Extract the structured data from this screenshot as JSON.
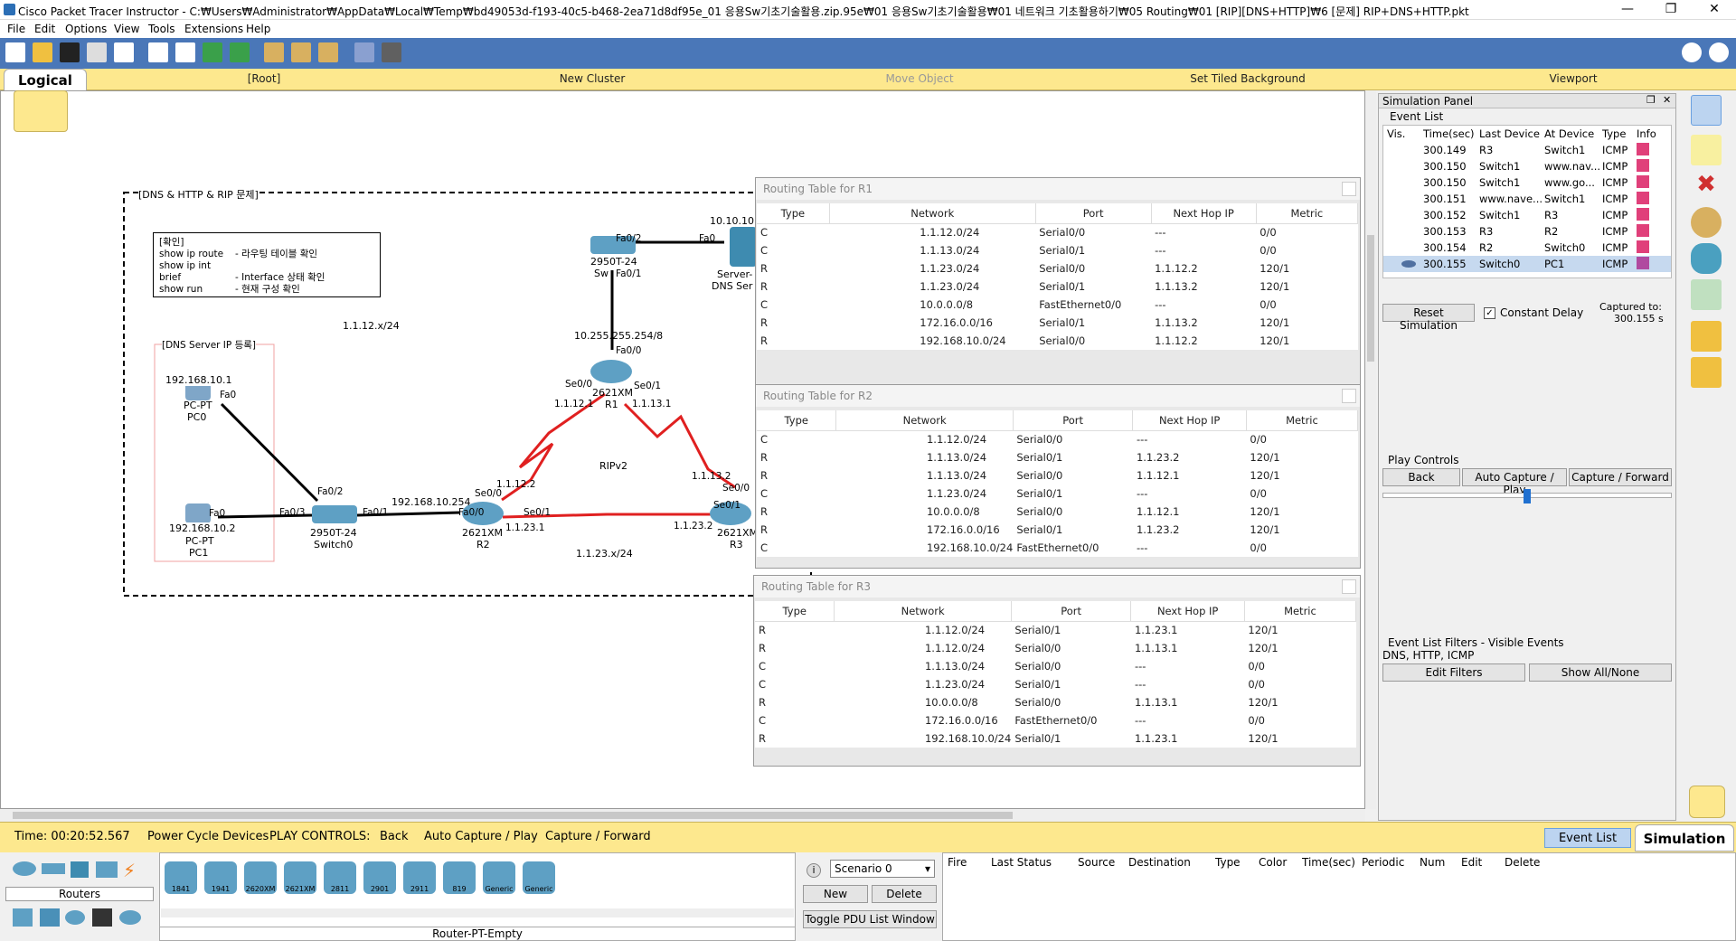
{
  "window": {
    "title": "Cisco Packet Tracer Instructor - C:₩Users₩Administrator₩AppData₩Local₩Temp₩bd49053d-f193-40c5-b468-2ea71d8df95e_01 응용Sw기초기술활용.zip.95e₩01 응용Sw기초기술활용₩01 네트워크 기초활용하기₩05 Routing₩01 [RIP][DNS+HTTP]₩6 [문제] RIP+DNS+HTTP.pkt"
  },
  "menu": [
    "File",
    "Edit",
    "Options",
    "View",
    "Tools",
    "Extensions",
    "Help"
  ],
  "logicalbar": {
    "logical": "Logical",
    "root": "[Root]",
    "new_cluster": "New Cluster",
    "move_object": "Move Object",
    "set_tiled_bg": "Set Tiled Background",
    "viewport": "Viewport"
  },
  "topology": {
    "cluster_label": "[DNS & HTTP & RIP 문제]",
    "note_title": "[확인]",
    "note_lines": [
      {
        "cmd": "show ip route",
        "desc": "- 라우팅 테이블 확인"
      },
      {
        "cmd": "show ip int brief",
        "desc": "- Interface 상태 확인"
      },
      {
        "cmd": "show run",
        "desc": "- 현재 구성 확인"
      }
    ],
    "dns_box_label": "[DNS Server IP 등록]",
    "net_1_1_12": "1.1.12.x/24",
    "net_1_1_23": "1.1.23.x/24",
    "ripv2": "RIPv2",
    "pc0": {
      "ip": "192.168.10.1",
      "model": "PC-PT",
      "name": "PC0",
      "port": "Fa0"
    },
    "pc1": {
      "ip": "192.168.10.2",
      "model": "PC-PT",
      "name": "PC1",
      "port": "Fa0"
    },
    "switch0": {
      "model": "2950T-24",
      "name": "Switch0",
      "p1": "Fa0/2",
      "p2": "Fa0/3",
      "p3": "Fa0/1"
    },
    "r2": {
      "model": "2621XM",
      "name": "R2",
      "fa": "Fa0/0",
      "se0": "Se0/0",
      "se1": "Se0/1",
      "gw": "192.168.10.254",
      "ip12": "1.1.12.2",
      "ip23": "1.1.23.1"
    },
    "r1": {
      "model": "2621XM",
      "name": "R1",
      "fa": "Fa0/0",
      "se0": "Se0/0",
      "se1": "Se0/1",
      "ip12": "1.1.12.1",
      "ip13": "1.1.13.1",
      "lan": "10.255.255.254/8"
    },
    "r3": {
      "model": "2621XM",
      "name": "R3",
      "se0": "Se0/0",
      "se1": "Se0/1",
      "ip13": "1.1.13.2",
      "ip23": "1.1.23.2"
    },
    "switch1": {
      "model": "2950T-24",
      "name": "Sw",
      "p1": "Fa0/2",
      "p2": "Fa0/1"
    },
    "server": {
      "name": "Server-",
      "name2": "DNS Ser",
      "ip": "10.10.10.",
      "port": "Fa0"
    }
  },
  "routing_tables": [
    {
      "title": "Routing Table for R1",
      "headers": [
        "Type",
        "Network",
        "Port",
        "Next Hop IP",
        "Metric"
      ],
      "rows": [
        [
          "C",
          "1.1.12.0/24",
          "Serial0/0",
          "---",
          "0/0"
        ],
        [
          "C",
          "1.1.13.0/24",
          "Serial0/1",
          "---",
          "0/0"
        ],
        [
          "R",
          "1.1.23.0/24",
          "Serial0/0",
          "1.1.12.2",
          "120/1"
        ],
        [
          "R",
          "1.1.23.0/24",
          "Serial0/1",
          "1.1.13.2",
          "120/1"
        ],
        [
          "C",
          "10.0.0.0/8",
          "FastEthernet0/0",
          "---",
          "0/0"
        ],
        [
          "R",
          "172.16.0.0/16",
          "Serial0/1",
          "1.1.13.2",
          "120/1"
        ],
        [
          "R",
          "192.168.10.0/24",
          "Serial0/0",
          "1.1.12.2",
          "120/1"
        ]
      ]
    },
    {
      "title": "Routing Table for R2",
      "headers": [
        "Type",
        "Network",
        "Port",
        "Next Hop IP",
        "Metric"
      ],
      "rows": [
        [
          "C",
          "1.1.12.0/24",
          "Serial0/0",
          "---",
          "0/0"
        ],
        [
          "R",
          "1.1.13.0/24",
          "Serial0/1",
          "1.1.23.2",
          "120/1"
        ],
        [
          "R",
          "1.1.13.0/24",
          "Serial0/0",
          "1.1.12.1",
          "120/1"
        ],
        [
          "C",
          "1.1.23.0/24",
          "Serial0/1",
          "---",
          "0/0"
        ],
        [
          "R",
          "10.0.0.0/8",
          "Serial0/0",
          "1.1.12.1",
          "120/1"
        ],
        [
          "R",
          "172.16.0.0/16",
          "Serial0/1",
          "1.1.23.2",
          "120/1"
        ],
        [
          "C",
          "192.168.10.0/24",
          "FastEthernet0/0",
          "---",
          "0/0"
        ]
      ]
    },
    {
      "title": "Routing Table for R3",
      "headers": [
        "Type",
        "Network",
        "Port",
        "Next Hop IP",
        "Metric"
      ],
      "rows": [
        [
          "R",
          "1.1.12.0/24",
          "Serial0/1",
          "1.1.23.1",
          "120/1"
        ],
        [
          "R",
          "1.1.12.0/24",
          "Serial0/0",
          "1.1.13.1",
          "120/1"
        ],
        [
          "C",
          "1.1.13.0/24",
          "Serial0/0",
          "---",
          "0/0"
        ],
        [
          "C",
          "1.1.23.0/24",
          "Serial0/1",
          "---",
          "0/0"
        ],
        [
          "R",
          "10.0.0.0/8",
          "Serial0/0",
          "1.1.13.1",
          "120/1"
        ],
        [
          "C",
          "172.16.0.0/16",
          "FastEthernet0/0",
          "---",
          "0/0"
        ],
        [
          "R",
          "192.168.10.0/24",
          "Serial0/1",
          "1.1.23.1",
          "120/1"
        ]
      ]
    }
  ],
  "sim_panel": {
    "title": "Simulation Panel",
    "event_list": "Event List",
    "headers": [
      "Vis.",
      "Time(sec)",
      "Last Device",
      "At Device",
      "Type",
      "Info"
    ],
    "events": [
      {
        "time": "300.149",
        "last": "R3",
        "at": "Switch1",
        "type": "ICMP",
        "color": "#e0407a"
      },
      {
        "time": "300.150",
        "last": "Switch1",
        "at": "www.nav...",
        "type": "ICMP",
        "color": "#e0407a"
      },
      {
        "time": "300.150",
        "last": "Switch1",
        "at": "www.go...",
        "type": "ICMP",
        "color": "#e0407a"
      },
      {
        "time": "300.151",
        "last": "www.nave...",
        "at": "Switch1",
        "type": "ICMP",
        "color": "#e0407a"
      },
      {
        "time": "300.152",
        "last": "Switch1",
        "at": "R3",
        "type": "ICMP",
        "color": "#e0407a"
      },
      {
        "time": "300.153",
        "last": "R3",
        "at": "R2",
        "type": "ICMP",
        "color": "#e0407a"
      },
      {
        "time": "300.154",
        "last": "R2",
        "at": "Switch0",
        "type": "ICMP",
        "color": "#e0407a"
      },
      {
        "time": "300.155",
        "last": "Switch0",
        "at": "PC1",
        "type": "ICMP",
        "color": "#b04aa0"
      }
    ],
    "reset": "Reset Simulation",
    "constant_delay": "Constant Delay",
    "captured_label": "Captured to:",
    "captured_value": "300.155 s",
    "play_controls": "Play Controls",
    "back": "Back",
    "auto_capture": "Auto Capture / Play",
    "capture_forward": "Capture / Forward",
    "filters_title": "Event List Filters - Visible Events",
    "filters_value": "DNS, HTTP, ICMP",
    "edit_filters": "Edit Filters",
    "show_all": "Show All/None"
  },
  "statusbar": {
    "time": "Time: 00:20:52.567",
    "power_cycle": "Power Cycle Devices",
    "play_controls": "PLAY CONTROLS:",
    "back": "Back",
    "auto_capture": "Auto Capture / Play",
    "capture_forward": "Capture / Forward",
    "event_list": "Event List",
    "simulation": "Simulation"
  },
  "bottom": {
    "category": "Routers",
    "models": [
      "1841",
      "1941",
      "2620XM",
      "2621XM",
      "2811",
      "2901",
      "2911",
      "819",
      "Generic",
      "Generic"
    ],
    "selected_model": "Router-PT-Empty",
    "scenario": "Scenario 0",
    "new": "New",
    "delete": "Delete",
    "toggle_pdu": "Toggle PDU List Window",
    "pdu_headers": [
      "Fire",
      "Last Status",
      "Source",
      "Destination",
      "Type",
      "Color",
      "Time(sec)",
      "Periodic",
      "Num",
      "Edit",
      "Delete"
    ]
  },
  "colors": {
    "toolbar": "#4a77b8",
    "yellow_bar": "#fde88e",
    "link_serial": "#e02020",
    "link_ethernet": "#000000",
    "port_up": "#33cc33"
  }
}
